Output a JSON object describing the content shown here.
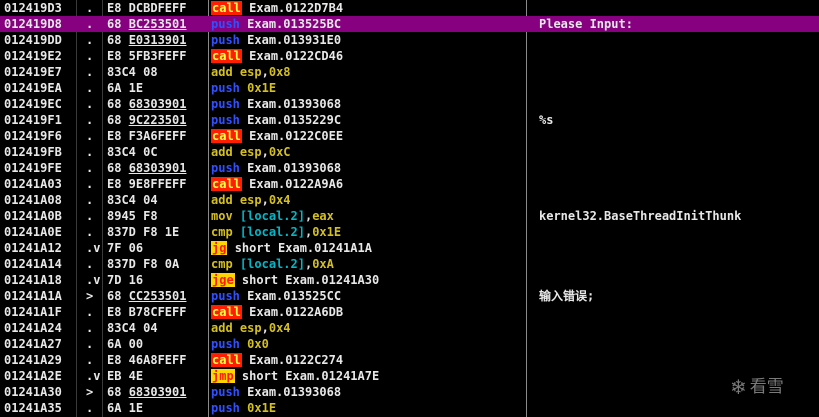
{
  "rows": [
    {
      "addr": "012419D3",
      "arrow": "",
      "dot": ".",
      "bytes": "E8 DCBDFEFF",
      "byte_ul": "",
      "op": "call",
      "args": [
        {
          "t": "Exam.0122D7B4",
          "k": ""
        }
      ],
      "comment": "",
      "selected": false
    },
    {
      "addr": "012419D8",
      "arrow": "",
      "dot": ".",
      "bytes": "68 ",
      "byte_ul": "BC253501",
      "op": "push",
      "args": [
        {
          "t": "Exam.013525BC",
          "k": ""
        }
      ],
      "comment": "Please Input:",
      "selected": true
    },
    {
      "addr": "012419DD",
      "arrow": "",
      "dot": ".",
      "bytes": "68 ",
      "byte_ul": "E0313901",
      "op": "push",
      "args": [
        {
          "t": "Exam.013931E0",
          "k": ""
        }
      ],
      "comment": "",
      "selected": false
    },
    {
      "addr": "012419E2",
      "arrow": "",
      "dot": ".",
      "bytes": "E8 5FB3FEFF",
      "byte_ul": "",
      "op": "call",
      "args": [
        {
          "t": "Exam.0122CD46",
          "k": ""
        }
      ],
      "comment": "",
      "selected": false
    },
    {
      "addr": "012419E7",
      "arrow": "",
      "dot": ".",
      "bytes": "83C4 08",
      "byte_ul": "",
      "op": "add",
      "args": [
        {
          "t": "esp",
          "k": "hex"
        },
        {
          "t": ",",
          "k": ""
        },
        {
          "t": "0x8",
          "k": "hex"
        }
      ],
      "comment": "",
      "selected": false
    },
    {
      "addr": "012419EA",
      "arrow": "",
      "dot": ".",
      "bytes": "6A 1E",
      "byte_ul": "",
      "op": "push",
      "args": [
        {
          "t": "0x1E",
          "k": "hex"
        }
      ],
      "comment": "",
      "selected": false
    },
    {
      "addr": "012419EC",
      "arrow": "",
      "dot": ".",
      "bytes": "68 ",
      "byte_ul": "68303901",
      "op": "push",
      "args": [
        {
          "t": "Exam.01393068",
          "k": ""
        }
      ],
      "comment": "",
      "selected": false
    },
    {
      "addr": "012419F1",
      "arrow": "",
      "dot": ".",
      "bytes": "68 ",
      "byte_ul": "9C223501",
      "op": "push",
      "args": [
        {
          "t": "Exam.0135229C",
          "k": ""
        }
      ],
      "comment": "%s",
      "selected": false
    },
    {
      "addr": "012419F6",
      "arrow": "",
      "dot": ".",
      "bytes": "E8 F3A6FEFF",
      "byte_ul": "",
      "op": "call",
      "args": [
        {
          "t": "Exam.0122C0EE",
          "k": ""
        }
      ],
      "comment": "",
      "selected": false
    },
    {
      "addr": "012419FB",
      "arrow": "",
      "dot": ".",
      "bytes": "83C4 0C",
      "byte_ul": "",
      "op": "add",
      "args": [
        {
          "t": "esp",
          "k": "hex"
        },
        {
          "t": ",",
          "k": ""
        },
        {
          "t": "0xC",
          "k": "hex"
        }
      ],
      "comment": "",
      "selected": false
    },
    {
      "addr": "012419FE",
      "arrow": "",
      "dot": ".",
      "bytes": "68 ",
      "byte_ul": "68303901",
      "op": "push",
      "args": [
        {
          "t": "Exam.01393068",
          "k": ""
        }
      ],
      "comment": "",
      "selected": false
    },
    {
      "addr": "01241A03",
      "arrow": "",
      "dot": ".",
      "bytes": "E8 9E8FFEFF",
      "byte_ul": "",
      "op": "call",
      "args": [
        {
          "t": "Exam.0122A9A6",
          "k": ""
        }
      ],
      "comment": "",
      "selected": false
    },
    {
      "addr": "01241A08",
      "arrow": "",
      "dot": ".",
      "bytes": "83C4 04",
      "byte_ul": "",
      "op": "add",
      "args": [
        {
          "t": "esp",
          "k": "hex"
        },
        {
          "t": ",",
          "k": ""
        },
        {
          "t": "0x4",
          "k": "hex"
        }
      ],
      "comment": "",
      "selected": false
    },
    {
      "addr": "01241A0B",
      "arrow": "",
      "dot": ".",
      "bytes": "8945 F8",
      "byte_ul": "",
      "op": "mov",
      "args": [
        {
          "t": "[local.2]",
          "k": "mem"
        },
        {
          "t": ",",
          "k": ""
        },
        {
          "t": "eax",
          "k": "hex"
        }
      ],
      "comment": "kernel32.BaseThreadInitThunk",
      "selected": false
    },
    {
      "addr": "01241A0E",
      "arrow": "",
      "dot": ".",
      "bytes": "837D F8 1E",
      "byte_ul": "",
      "op": "cmp",
      "args": [
        {
          "t": "[local.2]",
          "k": "mem"
        },
        {
          "t": ",",
          "k": ""
        },
        {
          "t": "0x1E",
          "k": "hex"
        }
      ],
      "comment": "",
      "selected": false
    },
    {
      "addr": "01241A12",
      "arrow": "",
      "dot": ".v",
      "bytes": "7F 06",
      "byte_ul": "",
      "op": "jg",
      "args": [
        {
          "t": "short Exam.01241A1A",
          "k": ""
        }
      ],
      "comment": "",
      "selected": false
    },
    {
      "addr": "01241A14",
      "arrow": "",
      "dot": ".",
      "bytes": "837D F8 0A",
      "byte_ul": "",
      "op": "cmp",
      "args": [
        {
          "t": "[local.2]",
          "k": "mem"
        },
        {
          "t": ",",
          "k": ""
        },
        {
          "t": "0xA",
          "k": "hex"
        }
      ],
      "comment": "",
      "selected": false
    },
    {
      "addr": "01241A18",
      "arrow": "",
      "dot": ".v",
      "bytes": "7D 16",
      "byte_ul": "",
      "op": "jge",
      "args": [
        {
          "t": "short Exam.01241A30",
          "k": ""
        }
      ],
      "comment": "",
      "selected": false
    },
    {
      "addr": "01241A1A",
      "arrow": ">",
      "dot": "",
      "bytes": "68 ",
      "byte_ul": "CC253501",
      "op": "push",
      "args": [
        {
          "t": "Exam.013525CC",
          "k": ""
        }
      ],
      "comment": "输入错误;",
      "selected": false
    },
    {
      "addr": "01241A1F",
      "arrow": "",
      "dot": ".",
      "bytes": "E8 B78CFEFF",
      "byte_ul": "",
      "op": "call",
      "args": [
        {
          "t": "Exam.0122A6DB",
          "k": ""
        }
      ],
      "comment": "",
      "selected": false
    },
    {
      "addr": "01241A24",
      "arrow": "",
      "dot": ".",
      "bytes": "83C4 04",
      "byte_ul": "",
      "op": "add",
      "args": [
        {
          "t": "esp",
          "k": "hex"
        },
        {
          "t": ",",
          "k": ""
        },
        {
          "t": "0x4",
          "k": "hex"
        }
      ],
      "comment": "",
      "selected": false
    },
    {
      "addr": "01241A27",
      "arrow": "",
      "dot": ".",
      "bytes": "6A 00",
      "byte_ul": "",
      "op": "push",
      "args": [
        {
          "t": "0x0",
          "k": "hex"
        }
      ],
      "comment": "",
      "selected": false
    },
    {
      "addr": "01241A29",
      "arrow": "",
      "dot": ".",
      "bytes": "E8 46A8FEFF",
      "byte_ul": "",
      "op": "call",
      "args": [
        {
          "t": "Exam.0122C274",
          "k": ""
        }
      ],
      "comment": "",
      "selected": false
    },
    {
      "addr": "01241A2E",
      "arrow": "",
      "dot": ".v",
      "bytes": "EB 4E",
      "byte_ul": "",
      "op": "jmp",
      "args": [
        {
          "t": "short Exam.01241A7E",
          "k": ""
        }
      ],
      "comment": "",
      "selected": false
    },
    {
      "addr": "01241A30",
      "arrow": ">",
      "dot": "",
      "bytes": "68 ",
      "byte_ul": "68303901",
      "op": "push",
      "args": [
        {
          "t": "Exam.01393068",
          "k": ""
        }
      ],
      "comment": "",
      "selected": false
    },
    {
      "addr": "01241A35",
      "arrow": "",
      "dot": ".",
      "bytes": "6A 1E",
      "byte_ul": "",
      "op": "push",
      "args": [
        {
          "t": "0x1E",
          "k": "hex"
        }
      ],
      "comment": "",
      "selected": false
    }
  ],
  "watermark": {
    "text": "看雪",
    "icon": "snowflake-icon"
  },
  "colors": {
    "background": "#000000",
    "selection": "#86007f",
    "call_bg": "#ff1f00",
    "call_fg": "#ffff40",
    "jmp_bg": "#ffd400",
    "jmp_fg": "#ff1a00",
    "push": "#3050ff",
    "imm": "#d4c020",
    "mem": "#00b8c8"
  }
}
